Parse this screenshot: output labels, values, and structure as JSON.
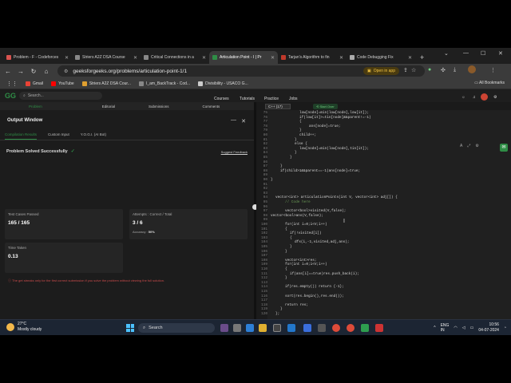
{
  "browser": {
    "tabs": [
      {
        "label": "Problem - F - Codeforces",
        "color": "#d9534f"
      },
      {
        "label": "Striers A2Z DSA Course",
        "color": "#888888"
      },
      {
        "label": "Critical Connections in a",
        "color": "#888888"
      },
      {
        "label": "Articulation Point - I | Pr",
        "color": "#2f8d46",
        "active": true
      },
      {
        "label": "Tarjan's Algorithm to fin",
        "color": "#c0392b"
      },
      {
        "label": "Code Debugging Fix",
        "color": "#aaaaaa"
      }
    ],
    "new_tab": "+",
    "url": "geeksforgeeks.org/problems/articulation-point-1/1",
    "open_in_app": "Open in app",
    "bookmarks": [
      {
        "label": "Gmail",
        "color": "#ea4335"
      },
      {
        "label": "YouTube",
        "color": "#ff0000"
      },
      {
        "label": "Striers A2Z DSA Cour...",
        "color": "#e0a030"
      },
      {
        "label": "I_am_BackTrack - Cod...",
        "color": "#888888"
      },
      {
        "label": "Divisibility - USACO G...",
        "color": "#cccccc"
      }
    ],
    "all_bookmarks": "All Bookmarks"
  },
  "site": {
    "logo": "GG",
    "search_placeholder": "Search...",
    "nav": [
      "Courses",
      "Tutorials",
      "Practice",
      "Jobs"
    ]
  },
  "problem_tabs": [
    "Problem",
    "Editorial",
    "Submissions",
    "Comments"
  ],
  "editor_header": {
    "language": "C++ (17)",
    "start_over": "Start Over"
  },
  "output": {
    "title": "Output Window",
    "tabs": [
      "Compilation Results",
      "Custom Input",
      "Y.O.G.I. (AI Bot)"
    ],
    "status": "Problem Solved Successfully",
    "feedback": "Suggest Feedback",
    "test_cases_label": "Test Cases Passed",
    "test_cases_value": "165 / 165",
    "attempts_label": "Attempts : Correct / Total",
    "attempts_value": "3 / 6",
    "accuracy_label": "Accuracy :",
    "accuracy_value": "50%",
    "time_label": "Time Taken",
    "time_value": "0.13",
    "note": "The get streaks only for the first correct submission if you solve the problem without viewing the full solution."
  },
  "code": {
    "lines": [
      {
        "n": "75",
        "indent": 6,
        "text": "low[node]=min(low[node],low[it]);"
      },
      {
        "n": "76",
        "indent": 6,
        "text": "if(low[it]>=tin[node]&&parent!=-1)"
      },
      {
        "n": "77",
        "indent": 6,
        "text": "{"
      },
      {
        "n": "78",
        "indent": 8,
        "text": "ans[node]=true;"
      },
      {
        "n": "79",
        "indent": 6,
        "text": "}"
      },
      {
        "n": "80",
        "indent": 6,
        "text": "child++;"
      },
      {
        "n": "81",
        "indent": 5,
        "text": "}"
      },
      {
        "n": "82",
        "indent": 5,
        "text": "else {"
      },
      {
        "n": "83",
        "indent": 6,
        "text": "low[node]=min(low[node],tin[it]);"
      },
      {
        "n": "84",
        "indent": 5,
        "text": "}"
      },
      {
        "n": "85",
        "indent": 4,
        "text": "}"
      },
      {
        "n": "86",
        "indent": 0,
        "text": ""
      },
      {
        "n": "87",
        "indent": 2,
        "text": "}"
      },
      {
        "n": "88",
        "indent": 2,
        "text": "if(child>1&&parent==-1)ans[node]=true;"
      },
      {
        "n": "89",
        "indent": 0,
        "text": ""
      },
      {
        "n": "90",
        "indent": 0,
        "text": "}"
      },
      {
        "n": "91",
        "indent": 0,
        "text": ""
      },
      {
        "n": "92",
        "indent": 0,
        "text": ""
      },
      {
        "n": "93",
        "indent": 0,
        "text": ""
      },
      {
        "n": "94",
        "indent": 1,
        "text": "vector<int> articulationPoints(int V, vector<int> adj[]) {"
      },
      {
        "n": "95",
        "indent": 3,
        "text": "// Code here"
      },
      {
        "n": "96",
        "indent": 0,
        "text": ""
      },
      {
        "n": "97",
        "indent": 3,
        "text": "vector<bool>visited(V,false);"
      },
      {
        "n": "98",
        "indent": 0,
        "text": "vector<bool>ans(V,false);"
      },
      {
        "n": "99",
        "indent": 0,
        "text": ""
      },
      {
        "n": "100",
        "indent": 3,
        "text": "for(int i=0;i<V;i++)"
      },
      {
        "n": "101",
        "indent": 3,
        "text": "{"
      },
      {
        "n": "102",
        "indent": 4,
        "text": "if(!visited[i])"
      },
      {
        "n": "103",
        "indent": 4,
        "text": "{"
      },
      {
        "n": "104",
        "indent": 5,
        "text": "dfs(i,-1,visited,adj,ans);"
      },
      {
        "n": "105",
        "indent": 4,
        "text": "}"
      },
      {
        "n": "106",
        "indent": 3,
        "text": "}"
      },
      {
        "n": "107",
        "indent": 0,
        "text": ""
      },
      {
        "n": "108",
        "indent": 3,
        "text": "vector<int>res;"
      },
      {
        "n": "109",
        "indent": 3,
        "text": "for(int i=0;i<V;i++)"
      },
      {
        "n": "110",
        "indent": 3,
        "text": "{"
      },
      {
        "n": "111",
        "indent": 4,
        "text": "if(ans[i]==true)res.push_back(i);"
      },
      {
        "n": "112",
        "indent": 3,
        "text": "}"
      },
      {
        "n": "113",
        "indent": 0,
        "text": ""
      },
      {
        "n": "114",
        "indent": 3,
        "text": "if(res.empty()) return {-1};"
      },
      {
        "n": "115",
        "indent": 0,
        "text": ""
      },
      {
        "n": "116",
        "indent": 3,
        "text": "sort(res.begin(),res.end());"
      },
      {
        "n": "117",
        "indent": 0,
        "text": ""
      },
      {
        "n": "118",
        "indent": 3,
        "text": "return res;"
      },
      {
        "n": "119",
        "indent": 2,
        "text": "}"
      },
      {
        "n": "120",
        "indent": 1,
        "text": "};"
      }
    ]
  },
  "editor_bottom": {
    "custom_input": "Custom Input",
    "compile_run": "Compile & Run",
    "submit": "Submit"
  },
  "taskbar": {
    "temperature": "27°C",
    "condition": "Mostly cloudy",
    "search": "Search",
    "lang1": "ENG",
    "lang2": "IN",
    "time": "10:56",
    "date": "04-07-2024"
  }
}
